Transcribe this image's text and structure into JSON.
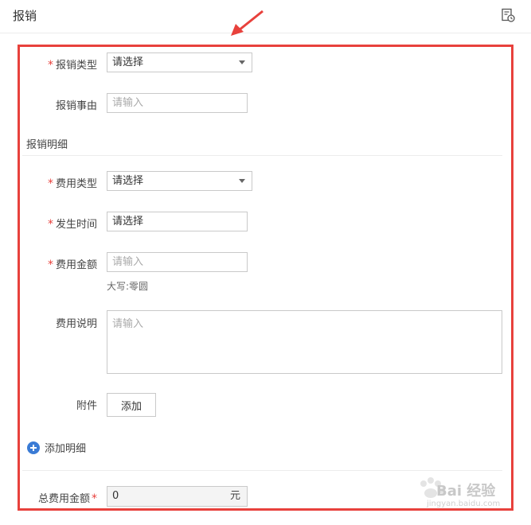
{
  "header": {
    "title": "报销",
    "history_icon": "history-icon"
  },
  "form": {
    "reimburse_type": {
      "label": "报销类型",
      "required": "*",
      "value": "请选择"
    },
    "reason": {
      "label": "报销事由",
      "placeholder": "请输入"
    },
    "detail_section": "报销明细",
    "expense_type": {
      "label": "费用类型",
      "required": "*",
      "value": "请选择"
    },
    "occur_time": {
      "label": "发生时间",
      "required": "*",
      "value": "请选择"
    },
    "amount": {
      "label": "费用金额",
      "required": "*",
      "placeholder": "请输入",
      "hint": "大写:零圆"
    },
    "description": {
      "label": "费用说明",
      "placeholder": "请输入"
    },
    "attachment": {
      "label": "附件",
      "button": "添加"
    },
    "add_detail": "添加明细",
    "total": {
      "label": "总费用金额",
      "required": "*",
      "value": "0",
      "unit": "元"
    }
  },
  "colors": {
    "required": "#e8413c",
    "highlight_border": "#e8413c",
    "accent": "#3a7bd5"
  },
  "watermark": {
    "text": "Bai 经验",
    "sub": "jingyan.baidu.com"
  }
}
